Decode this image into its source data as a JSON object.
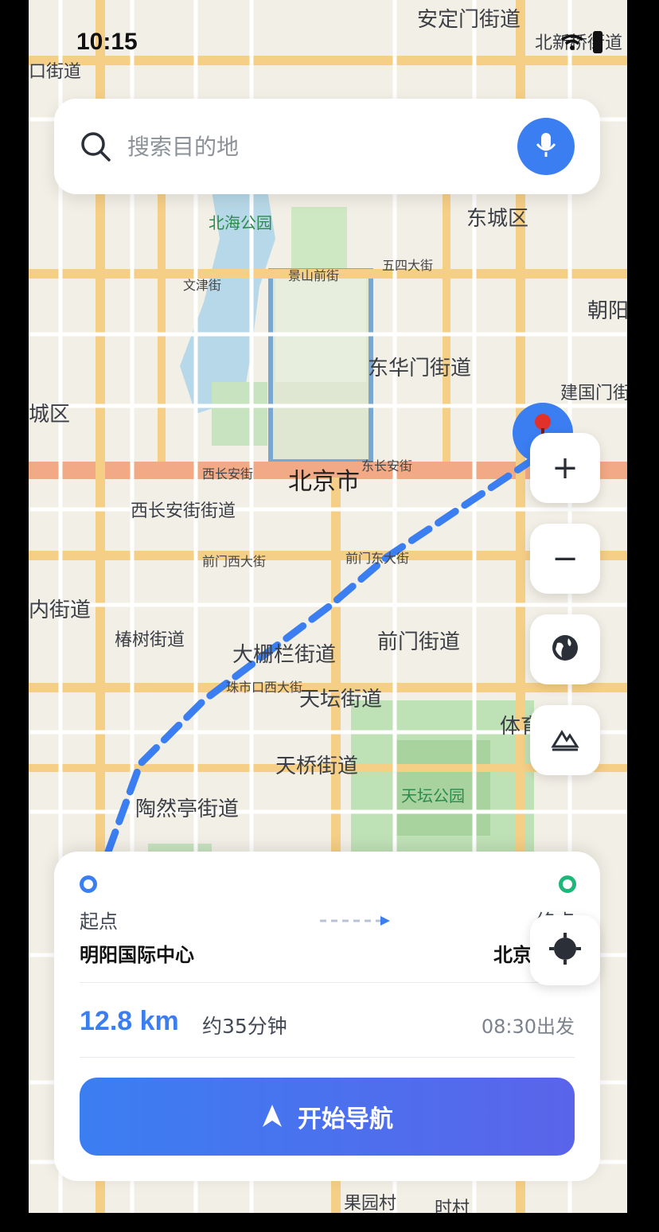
{
  "status_bar": {
    "time": "10:15"
  },
  "search": {
    "placeholder": "搜索目的地"
  },
  "map": {
    "labels": {
      "dingmen": "安定门街道",
      "beixinqiao": "北新桥街道",
      "dongcheng": "东城区",
      "beihai": "北海公园",
      "chaoyang": "朝阳",
      "donghuamen": "东华门街道",
      "jianguomen": "建国门街",
      "xicheng": "城区",
      "beijing": "北京市",
      "xichangan": "西长安街街道",
      "chunshu": "椿树街道",
      "dashilan": "大栅栏街道",
      "qianmen": "前门街道",
      "tiantan": "天坛街道",
      "tianqiao": "天桥街道",
      "tiantanpark": "天坛公园",
      "taoranting": "陶然亭街道",
      "guoyuan": "果园村",
      "shicun": "时村",
      "neijie": "内街道",
      "tiyu": "体育",
      "andingmen_st": "安定门街道",
      "jiedao_left": "口街道",
      "chang_an_e": "东长安街",
      "chang_an_w": "西长安街",
      "qianmenxi": "前门西大街",
      "qianmendong": "前门东大街",
      "wusi": "五四大街",
      "jingshan": "景山前街",
      "wenjin": "文津街",
      "zhushikou": "珠市口西大街"
    }
  },
  "controls": {
    "zoom_in": "+",
    "zoom_out": "−"
  },
  "route": {
    "start_label": "起点",
    "end_label": "终点",
    "start_name": "明阳国际中心",
    "end_name": "北京",
    "distance": "12.8 km",
    "duration": "约35分钟",
    "depart": "08:30出发",
    "nav_label": "开始导航"
  },
  "colors": {
    "accent": "#3b7ef2",
    "end_dot": "#1fb67a",
    "pin": "#e0312b",
    "gradient_end": "#5a64ea"
  }
}
